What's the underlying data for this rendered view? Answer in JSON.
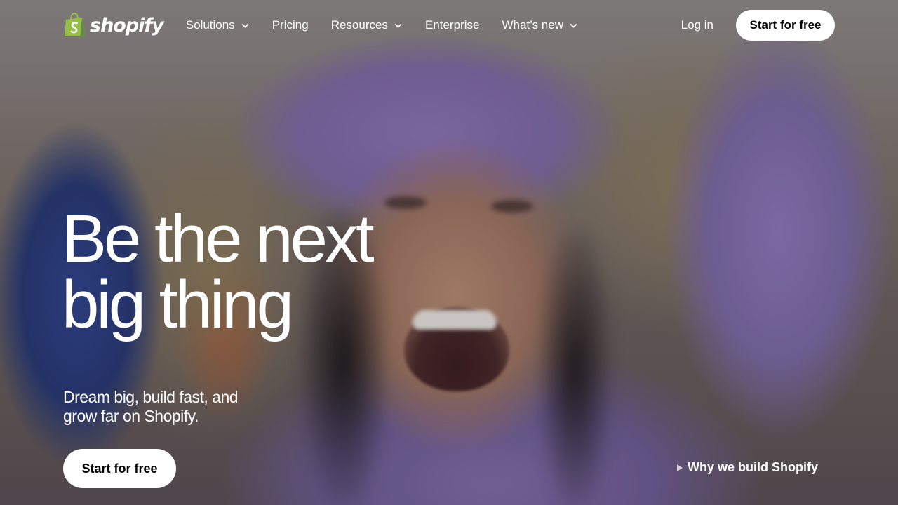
{
  "brand": {
    "name": "shopify",
    "logo_icon": "shopping-bag-icon",
    "logo_color": "#95BF47"
  },
  "nav": {
    "items": [
      {
        "label": "Solutions",
        "has_dropdown": true
      },
      {
        "label": "Pricing",
        "has_dropdown": false
      },
      {
        "label": "Resources",
        "has_dropdown": true
      },
      {
        "label": "Enterprise",
        "has_dropdown": false
      },
      {
        "label": "What’s new",
        "has_dropdown": true
      }
    ],
    "login_label": "Log in",
    "cta_label": "Start for free"
  },
  "hero": {
    "headline_line1": "Be the next",
    "headline_line2": "big thing",
    "subhead": "Dream big, build fast, and grow far on Shopify.",
    "cta_label": "Start for free",
    "video_link_label": "Why we build Shopify",
    "video_icon": "play-icon"
  },
  "colors": {
    "cta_background": "#FFFFFF",
    "cta_text": "#000000",
    "text": "#FFFFFF"
  }
}
